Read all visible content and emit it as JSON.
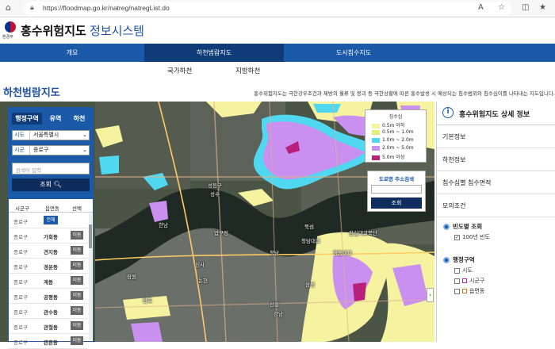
{
  "browser": {
    "url": "https://floodmap.go.kr/natreg/natregList.do",
    "home_icon": "home-icon",
    "lock_icon": "lock-icon"
  },
  "header": {
    "logo_text": "환경부",
    "title_main": "홍수위험지도 ",
    "title_sub": "정보시스템"
  },
  "nav": {
    "tabs": [
      "개요",
      "하천범람지도",
      "도시침수지도"
    ],
    "active": 1
  },
  "subnav": {
    "items": [
      "국가하천",
      "지방하천"
    ]
  },
  "page": {
    "title": "하천범람지도",
    "description": "홍수위험지도는 극한강우조건과 제방의 월류 및 붕괴 등 극한상황에 따른 홍수발생 시 예상되는 침수범위와 침수심이를 나타내는 지도입니다."
  },
  "left_panel": {
    "tabs": [
      "행정구역",
      "유역",
      "하천"
    ],
    "sido_label": "시도",
    "sido_value": "서울특별시",
    "sigungu_label": "시군구",
    "sigungu_value": "종로구",
    "search_placeholder": "검색어 입력",
    "search_button": "조회",
    "table_headers": [
      "시군구",
      "읍면동",
      "선택"
    ],
    "rows": [
      {
        "sigungu": "종로구",
        "dong": "",
        "action": "전체"
      },
      {
        "sigungu": "종로구",
        "dong": "가회동",
        "action": "이동"
      },
      {
        "sigungu": "종로구",
        "dong": "견지동",
        "action": "이동"
      },
      {
        "sigungu": "종로구",
        "dong": "경운동",
        "action": "이동"
      },
      {
        "sigungu": "종로구",
        "dong": "계동",
        "action": "이동"
      },
      {
        "sigungu": "종로구",
        "dong": "공평동",
        "action": "이동"
      },
      {
        "sigungu": "종로구",
        "dong": "관수동",
        "action": "이동"
      },
      {
        "sigungu": "종로구",
        "dong": "관철동",
        "action": "이동"
      },
      {
        "sigungu": "종로구",
        "dong": "관훈동",
        "action": "이동"
      },
      {
        "sigungu": "종로구",
        "dong": "교남동",
        "action": "이동"
      }
    ]
  },
  "legend": {
    "title": "침수심",
    "items": [
      {
        "label": "0.5m 이하",
        "color": "#f5f2a0"
      },
      {
        "label": "0.5m ~ 1.0m",
        "color": "#e4ef7a"
      },
      {
        "label": "1.0m ~ 2.0m",
        "color": "#4fd8f0"
      },
      {
        "label": "2.0m ~ 5.0m",
        "color": "#c990f0"
      },
      {
        "label": "5.0m 이상",
        "color": "#b8207a"
      }
    ]
  },
  "road_search": {
    "title": "도로명 주소검색",
    "button": "조회"
  },
  "map_labels": [
    "성동구",
    "성수",
    "뚝섬",
    "잠실대교북단",
    "압구정",
    "청담",
    "강남",
    "논현",
    "신사",
    "한남",
    "잠원",
    "반포",
    "선릉",
    "삼성",
    "청담대교",
    "영동대교"
  ],
  "right_panel": {
    "title": "홍수위험지도 상세 정보",
    "items": [
      "기본정보",
      "하천정보",
      "침수심별 침수면적",
      "모의조건"
    ],
    "freq_title": "빈도별 조회",
    "freq_option": "100년 빈도",
    "admin_title": "행정구역",
    "admin_options": [
      "시도",
      "시군구",
      "읍면동"
    ]
  },
  "colors": {
    "brand_blue": "#1a5aa8",
    "dark_navy": "#0f2d5c"
  }
}
